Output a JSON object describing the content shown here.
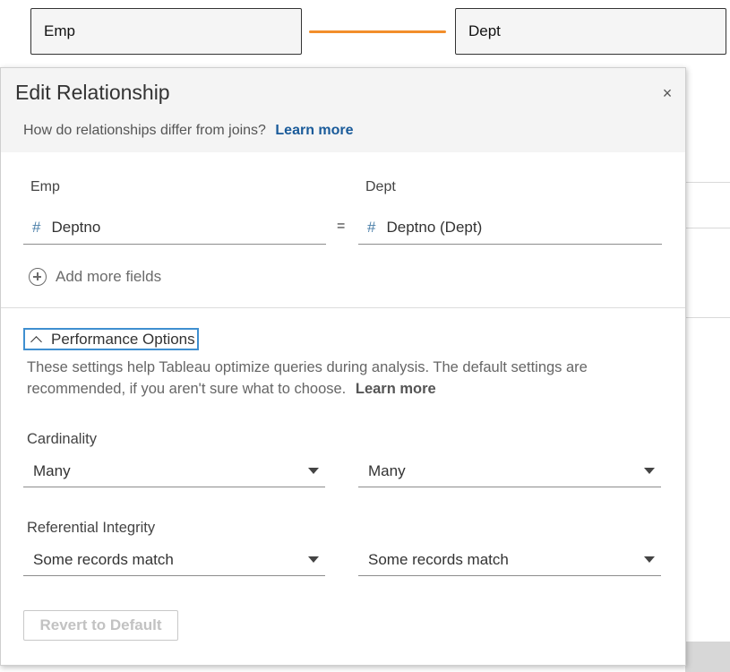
{
  "canvas": {
    "left_table": "Emp",
    "right_table": "Dept",
    "relationship_color": "#f28e2b"
  },
  "dialog": {
    "title": "Edit Relationship",
    "close_icon": "×",
    "subtitle": "How do relationships differ from joins?",
    "learn_more": "Learn more"
  },
  "relationship": {
    "left_label": "Emp",
    "right_label": "Dept",
    "operator": "=",
    "left_field": "Deptno",
    "right_field": "Deptno (Dept)",
    "field_type_icon": "#",
    "add_more": "Add more fields"
  },
  "performance": {
    "toggle_label": "Performance Options",
    "description": "These settings help Tableau optimize queries during analysis. The default settings are recommended, if you aren't sure what to choose.",
    "learn_more": "Learn more",
    "cardinality_label": "Cardinality",
    "cardinality_left": "Many",
    "cardinality_right": "Many",
    "integrity_label": "Referential Integrity",
    "integrity_left": "Some records match",
    "integrity_right": "Some records match",
    "revert_button": "Revert to Default"
  },
  "colors": {
    "link": "#1a5b9a",
    "focus_outline": "#3f8fd0",
    "field_type_icon": "#4b7fa8"
  }
}
